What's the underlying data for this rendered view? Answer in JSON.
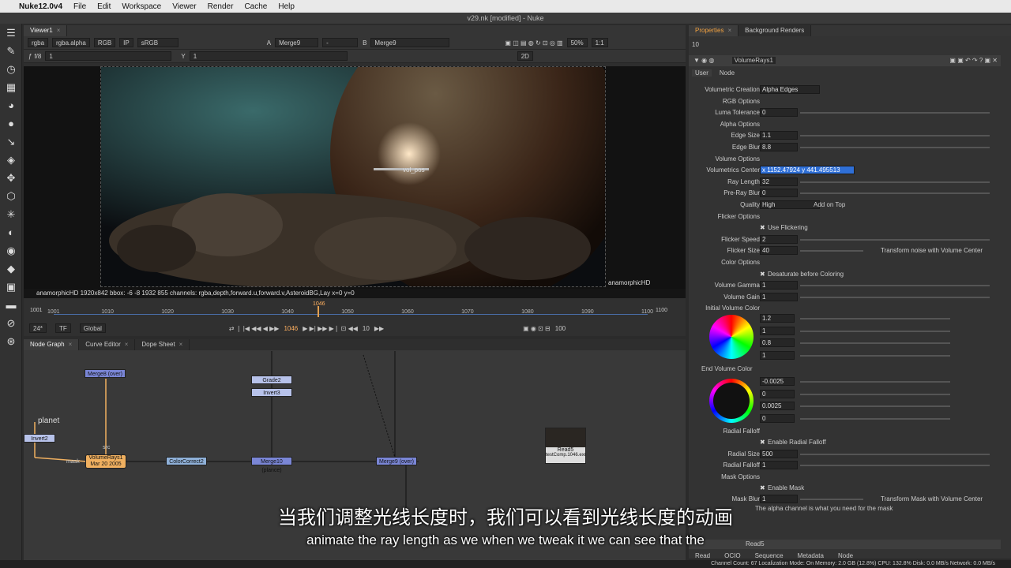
{
  "menubar": {
    "app": "Nuke12.0v4",
    "items": [
      "File",
      "Edit",
      "Workspace",
      "Viewer",
      "Render",
      "Cache",
      "Help"
    ]
  },
  "window": {
    "title": "v29.nk [modified] - Nuke"
  },
  "viewer": {
    "tab": "Viewer1",
    "rgba": "rgba",
    "alpha": "rgba.alpha",
    "rgb": "RGB",
    "ip": "IP",
    "colorspace": "sRGB",
    "a_input": "Merge9",
    "dash": "-",
    "b_input": "Merge9",
    "zoom": "50%",
    "ratio": "1:1",
    "fstop": "f/8",
    "gain": "1",
    "y_label": "Y",
    "gamma": "1",
    "mode": "2D",
    "format_label": "anamorphicHD",
    "vol_pos": "vol_pos",
    "info": "anamorphicHD 1920x842  bbox: -6 -8 1932 855 channels: rgba,depth,forward.u,forward.v,AsteroidBG,Lay  x=0 y=0"
  },
  "timeline": {
    "start": "1001",
    "end": "1100",
    "current": "1046",
    "ticks": [
      "1001",
      "1010",
      "1020",
      "1030",
      "1040",
      "1050",
      "1060",
      "1070",
      "1080",
      "1090",
      "1100"
    ],
    "fps": "24*",
    "tf": "TF",
    "scope": "Global",
    "frame": "1046",
    "step": "10",
    "end_frame": "100"
  },
  "nodegraph": {
    "tabs": [
      "Node Graph",
      "Curve Editor",
      "Dope Sheet"
    ],
    "nodes": {
      "merge8": "Merge8 (over)",
      "grade2": "Grade2",
      "invert3": "Invert3",
      "planet": "planet",
      "invert2": "Invert2",
      "volumerays": "VolumeRays1",
      "volumerays_date": "Mar 20 2005",
      "colorcorrect": "ColorCorrect2",
      "merge10": "Merge10 (plance)",
      "merge9": "Merge9 (over)",
      "read5": "Read5",
      "read5_file": "testComp.1046.exr",
      "mask": "mask",
      "src": "src"
    }
  },
  "props": {
    "tabs": [
      "Properties",
      "Background Renders"
    ],
    "node_count": "10",
    "node_name": "VolumeRays1",
    "subtabs": [
      "User",
      "Node"
    ],
    "rows": [
      {
        "label": "Volumetric Creation",
        "value": "Alpha Edges",
        "kind": "drop"
      },
      {
        "label": "RGB Options",
        "kind": "section"
      },
      {
        "label": "Luma Tolerance",
        "value": "0",
        "kind": "slider"
      },
      {
        "label": "Alpha Options",
        "kind": "section"
      },
      {
        "label": "Edge Size",
        "value": "1.1",
        "kind": "slider"
      },
      {
        "label": "Edge Blur",
        "value": "8.8",
        "kind": "slider"
      },
      {
        "label": "Volume Options",
        "kind": "section"
      },
      {
        "label": "Volumetrics Center",
        "value": "x 1152.47924 y 441.495513",
        "kind": "xy"
      },
      {
        "label": "Ray Length",
        "value": "32",
        "kind": "slider"
      },
      {
        "label": "Pre-Ray Blur",
        "value": "0",
        "kind": "slider"
      },
      {
        "label": "Quality",
        "value": "High",
        "extra": "Add on Top",
        "kind": "drop"
      },
      {
        "label": "Flicker Options",
        "kind": "section"
      },
      {
        "label": "Use Flickering",
        "kind": "check"
      },
      {
        "label": "Flicker Speed",
        "value": "2",
        "kind": "slider"
      },
      {
        "label": "Flicker Size",
        "value": "40",
        "extra": "Transform noise with Volume Center",
        "kind": "slider"
      },
      {
        "label": "Color Options",
        "kind": "section"
      },
      {
        "label": "Desaturate before Coloring",
        "kind": "check"
      },
      {
        "label": "Volume Gamma",
        "value": "1",
        "kind": "slider"
      },
      {
        "label": "Volume Gain",
        "value": "1",
        "kind": "slider"
      },
      {
        "label": "Initial Volume Color",
        "kind": "section"
      }
    ],
    "init_color": [
      "1.2",
      "1",
      "0.8",
      "1"
    ],
    "end_label": "End Volume Color",
    "end_color": [
      "-0.0025",
      "0",
      "0.0025",
      "0"
    ],
    "rows2": [
      {
        "label": "Radial Falloff",
        "kind": "section"
      },
      {
        "label": "Enable Radial Falloff",
        "kind": "check"
      },
      {
        "label": "Radial Size",
        "value": "500",
        "kind": "slider"
      },
      {
        "label": "Radial Falloff",
        "value": "1",
        "kind": "slider"
      },
      {
        "label": "Mask Options",
        "kind": "section"
      },
      {
        "label": "Enable Mask",
        "kind": "check"
      },
      {
        "label": "Mask Blur",
        "value": "1",
        "extra": "Transform Mask with Volume Center",
        "kind": "slider"
      }
    ],
    "mask_note": "The alpha channel is what you need for the mask",
    "bottom_node": "Read5",
    "bottom_tabs": [
      "Read",
      "OCIO",
      "Sequence",
      "Metadata",
      "Node"
    ]
  },
  "subtitles": {
    "cn": "当我们调整光线长度时，我们可以看到光线长度的动画",
    "en": "animate the ray length as we when we tweak it we can see that the"
  },
  "status": {
    "text": "Channel Count: 67  Localization Mode: On  Memory: 2.0 GB (12.8%)  CPU: 132.8%  Disk: 0.0 MB/s  Network: 0.0 MB/s"
  }
}
